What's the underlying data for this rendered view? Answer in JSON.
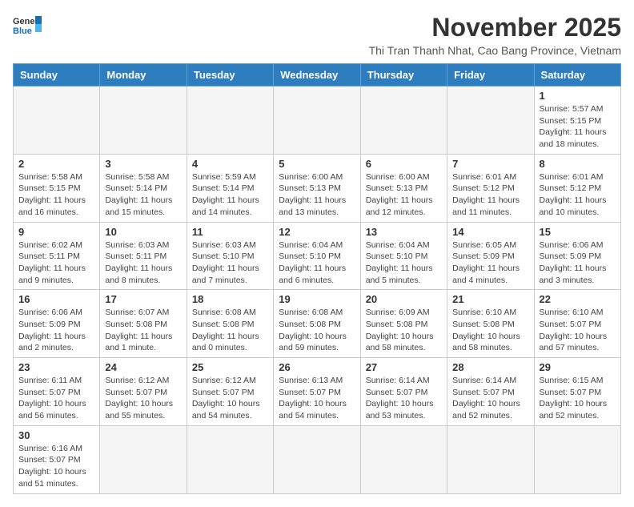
{
  "header": {
    "logo_general": "General",
    "logo_blue": "Blue",
    "month_title": "November 2025",
    "subtitle": "Thi Tran Thanh Nhat, Cao Bang Province, Vietnam"
  },
  "weekdays": [
    "Sunday",
    "Monday",
    "Tuesday",
    "Wednesday",
    "Thursday",
    "Friday",
    "Saturday"
  ],
  "weeks": [
    [
      {
        "day": "",
        "info": ""
      },
      {
        "day": "",
        "info": ""
      },
      {
        "day": "",
        "info": ""
      },
      {
        "day": "",
        "info": ""
      },
      {
        "day": "",
        "info": ""
      },
      {
        "day": "",
        "info": ""
      },
      {
        "day": "1",
        "info": "Sunrise: 5:57 AM\nSunset: 5:15 PM\nDaylight: 11 hours and 18 minutes."
      }
    ],
    [
      {
        "day": "2",
        "info": "Sunrise: 5:58 AM\nSunset: 5:15 PM\nDaylight: 11 hours and 16 minutes."
      },
      {
        "day": "3",
        "info": "Sunrise: 5:58 AM\nSunset: 5:14 PM\nDaylight: 11 hours and 15 minutes."
      },
      {
        "day": "4",
        "info": "Sunrise: 5:59 AM\nSunset: 5:14 PM\nDaylight: 11 hours and 14 minutes."
      },
      {
        "day": "5",
        "info": "Sunrise: 6:00 AM\nSunset: 5:13 PM\nDaylight: 11 hours and 13 minutes."
      },
      {
        "day": "6",
        "info": "Sunrise: 6:00 AM\nSunset: 5:13 PM\nDaylight: 11 hours and 12 minutes."
      },
      {
        "day": "7",
        "info": "Sunrise: 6:01 AM\nSunset: 5:12 PM\nDaylight: 11 hours and 11 minutes."
      },
      {
        "day": "8",
        "info": "Sunrise: 6:01 AM\nSunset: 5:12 PM\nDaylight: 11 hours and 10 minutes."
      }
    ],
    [
      {
        "day": "9",
        "info": "Sunrise: 6:02 AM\nSunset: 5:11 PM\nDaylight: 11 hours and 9 minutes."
      },
      {
        "day": "10",
        "info": "Sunrise: 6:03 AM\nSunset: 5:11 PM\nDaylight: 11 hours and 8 minutes."
      },
      {
        "day": "11",
        "info": "Sunrise: 6:03 AM\nSunset: 5:10 PM\nDaylight: 11 hours and 7 minutes."
      },
      {
        "day": "12",
        "info": "Sunrise: 6:04 AM\nSunset: 5:10 PM\nDaylight: 11 hours and 6 minutes."
      },
      {
        "day": "13",
        "info": "Sunrise: 6:04 AM\nSunset: 5:10 PM\nDaylight: 11 hours and 5 minutes."
      },
      {
        "day": "14",
        "info": "Sunrise: 6:05 AM\nSunset: 5:09 PM\nDaylight: 11 hours and 4 minutes."
      },
      {
        "day": "15",
        "info": "Sunrise: 6:06 AM\nSunset: 5:09 PM\nDaylight: 11 hours and 3 minutes."
      }
    ],
    [
      {
        "day": "16",
        "info": "Sunrise: 6:06 AM\nSunset: 5:09 PM\nDaylight: 11 hours and 2 minutes."
      },
      {
        "day": "17",
        "info": "Sunrise: 6:07 AM\nSunset: 5:08 PM\nDaylight: 11 hours and 1 minute."
      },
      {
        "day": "18",
        "info": "Sunrise: 6:08 AM\nSunset: 5:08 PM\nDaylight: 11 hours and 0 minutes."
      },
      {
        "day": "19",
        "info": "Sunrise: 6:08 AM\nSunset: 5:08 PM\nDaylight: 10 hours and 59 minutes."
      },
      {
        "day": "20",
        "info": "Sunrise: 6:09 AM\nSunset: 5:08 PM\nDaylight: 10 hours and 58 minutes."
      },
      {
        "day": "21",
        "info": "Sunrise: 6:10 AM\nSunset: 5:08 PM\nDaylight: 10 hours and 58 minutes."
      },
      {
        "day": "22",
        "info": "Sunrise: 6:10 AM\nSunset: 5:07 PM\nDaylight: 10 hours and 57 minutes."
      }
    ],
    [
      {
        "day": "23",
        "info": "Sunrise: 6:11 AM\nSunset: 5:07 PM\nDaylight: 10 hours and 56 minutes."
      },
      {
        "day": "24",
        "info": "Sunrise: 6:12 AM\nSunset: 5:07 PM\nDaylight: 10 hours and 55 minutes."
      },
      {
        "day": "25",
        "info": "Sunrise: 6:12 AM\nSunset: 5:07 PM\nDaylight: 10 hours and 54 minutes."
      },
      {
        "day": "26",
        "info": "Sunrise: 6:13 AM\nSunset: 5:07 PM\nDaylight: 10 hours and 54 minutes."
      },
      {
        "day": "27",
        "info": "Sunrise: 6:14 AM\nSunset: 5:07 PM\nDaylight: 10 hours and 53 minutes."
      },
      {
        "day": "28",
        "info": "Sunrise: 6:14 AM\nSunset: 5:07 PM\nDaylight: 10 hours and 52 minutes."
      },
      {
        "day": "29",
        "info": "Sunrise: 6:15 AM\nSunset: 5:07 PM\nDaylight: 10 hours and 52 minutes."
      }
    ],
    [
      {
        "day": "30",
        "info": "Sunrise: 6:16 AM\nSunset: 5:07 PM\nDaylight: 10 hours and 51 minutes."
      },
      {
        "day": "",
        "info": ""
      },
      {
        "day": "",
        "info": ""
      },
      {
        "day": "",
        "info": ""
      },
      {
        "day": "",
        "info": ""
      },
      {
        "day": "",
        "info": ""
      },
      {
        "day": "",
        "info": ""
      }
    ]
  ]
}
